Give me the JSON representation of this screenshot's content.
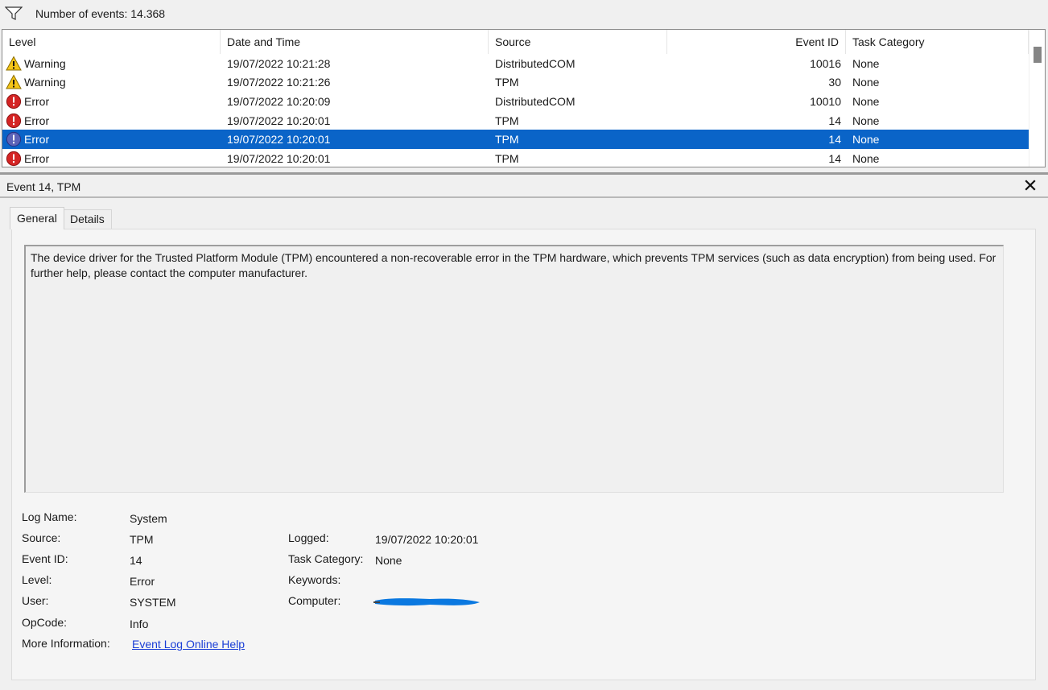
{
  "toolbar": {
    "filter_icon": "filter-funnel-icon",
    "event_count": "Number of events: 14.368"
  },
  "grid": {
    "columns": {
      "level": "Level",
      "date": "Date and Time",
      "source": "Source",
      "event_id": "Event ID",
      "category": "Task Category"
    },
    "rows": [
      {
        "level": "Warning",
        "icon": "warning-icon",
        "date": "19/07/2022 10:21:28",
        "source": "DistributedCOM",
        "event_id": "10016",
        "category": "None",
        "selected": false
      },
      {
        "level": "Warning",
        "icon": "warning-icon",
        "date": "19/07/2022 10:21:26",
        "source": "TPM",
        "event_id": "30",
        "category": "None",
        "selected": false
      },
      {
        "level": "Error",
        "icon": "error-icon",
        "date": "19/07/2022 10:20:09",
        "source": "DistributedCOM",
        "event_id": "10010",
        "category": "None",
        "selected": false
      },
      {
        "level": "Error",
        "icon": "error-icon",
        "date": "19/07/2022 10:20:01",
        "source": "TPM",
        "event_id": "14",
        "category": "None",
        "selected": false
      },
      {
        "level": "Error",
        "icon": "error-icon",
        "date": "19/07/2022 10:20:01",
        "source": "TPM",
        "event_id": "14",
        "category": "None",
        "selected": true
      },
      {
        "level": "Error",
        "icon": "error-icon",
        "date": "19/07/2022 10:20:01",
        "source": "TPM",
        "event_id": "14",
        "category": "None",
        "selected": false
      }
    ]
  },
  "detail": {
    "title": "Event 14, TPM",
    "tabs": {
      "general": "General",
      "details": "Details"
    },
    "description": "The device driver for the Trusted Platform Module (TPM) encountered a non-recoverable error in the TPM hardware, which prevents TPM services (such as data encryption) from being used. For further help, please contact the computer manufacturer.",
    "labels": {
      "log_name": "Log Name:",
      "source": "Source:",
      "event_id": "Event ID:",
      "level": "Level:",
      "user": "User:",
      "opcode": "OpCode:",
      "more_info": "More Information:",
      "logged": "Logged:",
      "task_category": "Task Category:",
      "keywords": "Keywords:",
      "computer": "Computer:"
    },
    "values": {
      "log_name": "System",
      "source": "TPM",
      "event_id": "14",
      "level": "Error",
      "user": "SYSTEM",
      "opcode": "Info",
      "more_info_link": "Event Log Online Help",
      "logged": "19/07/2022 10:20:01",
      "task_category": "None",
      "keywords": ""
    }
  },
  "colors": {
    "selection": "#0a64c8",
    "link": "#1a3ed6",
    "redaction": "#0a78e0"
  }
}
